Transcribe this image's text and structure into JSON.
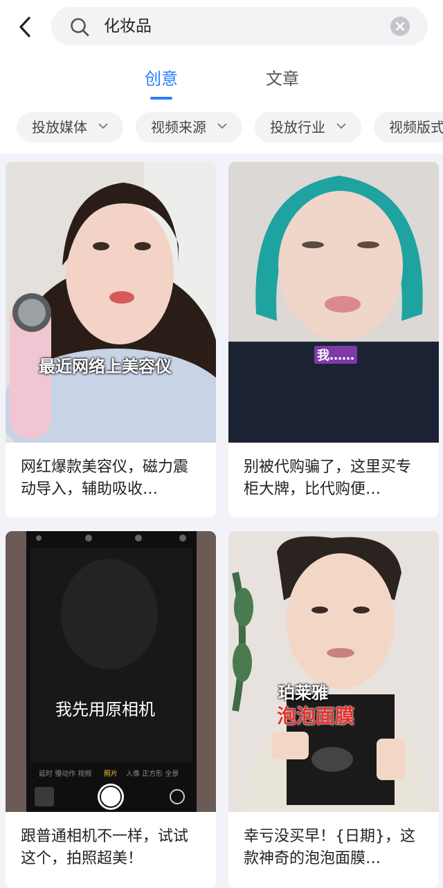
{
  "search": {
    "query": "化妆品",
    "back_icon": "back-arrow-icon",
    "search_icon": "search-icon",
    "clear_icon": "clear-icon"
  },
  "tabs": [
    {
      "label": "创意",
      "active": true
    },
    {
      "label": "文章",
      "active": false
    }
  ],
  "filters": [
    {
      "label": "投放媒体"
    },
    {
      "label": "视频来源"
    },
    {
      "label": "投放行业"
    },
    {
      "label": "视频版式"
    }
  ],
  "cards": [
    {
      "caption": "网红爆款美容仪，磁力震动导入，辅助吸收…",
      "overlay": "最近网络上美容仪"
    },
    {
      "caption": "别被代购骗了，这里买专柜大牌，比代购便…",
      "overlay": "我……"
    },
    {
      "caption": "跟普通相机不一样，试试这个，拍照超美！",
      "overlay": "我先用原相机"
    },
    {
      "caption": "幸亏没买早！{日期}，这款神奇的泡泡面膜…",
      "overlay_1": "珀莱雅",
      "overlay_2": "泡泡面膜"
    }
  ],
  "colors": {
    "accent": "#2d7cff",
    "background": "#f1f3f8"
  }
}
